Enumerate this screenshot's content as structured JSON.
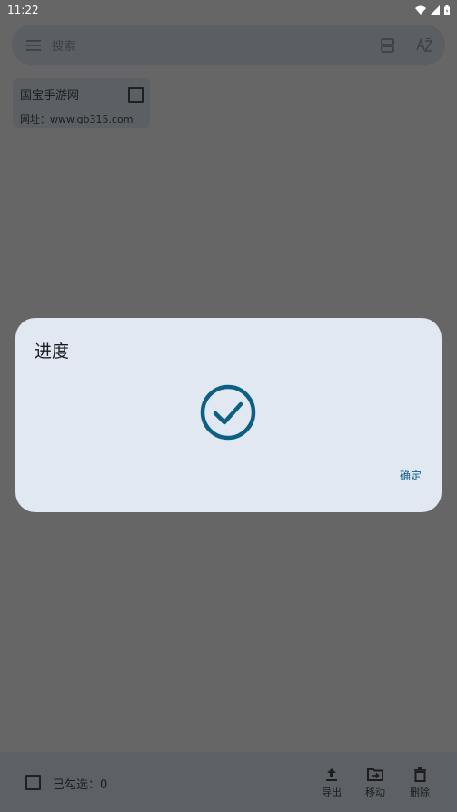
{
  "status_bar": {
    "time": "11:22"
  },
  "search": {
    "placeholder": "搜索"
  },
  "list": {
    "items": [
      {
        "title": "国宝手游网",
        "url": "网址：www.gb315.com"
      }
    ]
  },
  "dialog": {
    "title": "进度",
    "confirm_label": "确定",
    "status_icon": "check-circle-icon"
  },
  "bottom_bar": {
    "selected_label": "已勾选：0",
    "export_label": "导出",
    "move_label": "移动",
    "delete_label": "删除"
  },
  "colors": {
    "accent": "#0e5f84",
    "dialog_background": "#e2e8f1",
    "scrim": "#666666"
  }
}
